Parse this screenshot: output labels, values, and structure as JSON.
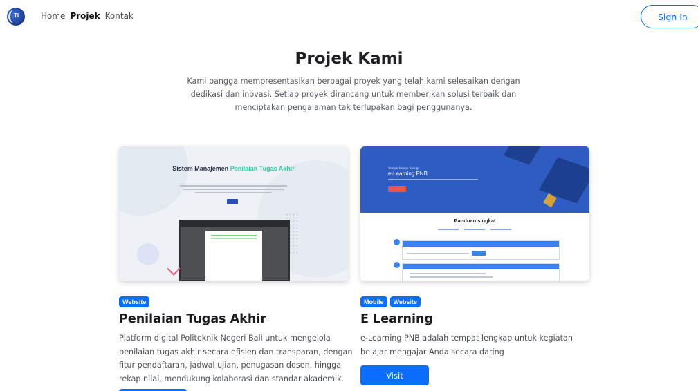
{
  "nav": {
    "links": [
      "Home",
      "Projek",
      "Kontak"
    ],
    "active": "Projek",
    "signin_label": "Sign In",
    "logo_text": "TI"
  },
  "hero": {
    "title": "Projek Kami",
    "description": "Kami bangga mempresentasikan berbagai proyek yang telah kami selesaikan dengan dedikasi dan inovasi. Setiap proyek dirancang untuk memberikan solusi terbaik dan menciptakan pengalaman tak terlupakan bagi penggunanya."
  },
  "projects": [
    {
      "badges": [
        "Website"
      ],
      "title": "Penilaian Tugas Akhir",
      "description": "Platform digital Politeknik Negeri Bali untuk mengelola penilaian tugas akhir secara efisien dan transparan, dengan fitur pendaftaran, jadwal ujian, penugasan dosen, hingga rekap nilai, mendukung kolaborasi dan standar akademik.",
      "thumb_heading": "Sistem Manajemen",
      "thumb_heading_highlight": "Penilaian Tugas Akhir"
    },
    {
      "badges": [
        "Mobile",
        "Website"
      ],
      "title": "E Learning",
      "description": "e-Learning PNB adalah tempat lengkap untuk kegiatan belajar mengajar Anda secara daring",
      "visit_label": "Visit",
      "thumb_small_label": "Tempat belajar daring!",
      "thumb_large_label": "e-Learning PNB",
      "thumb_section_title": "Panduan singkat"
    }
  ],
  "colors": {
    "primary": "#0d6efd",
    "hero_banner": "#2f5cc0",
    "highlight_green": "#35c6a0"
  }
}
